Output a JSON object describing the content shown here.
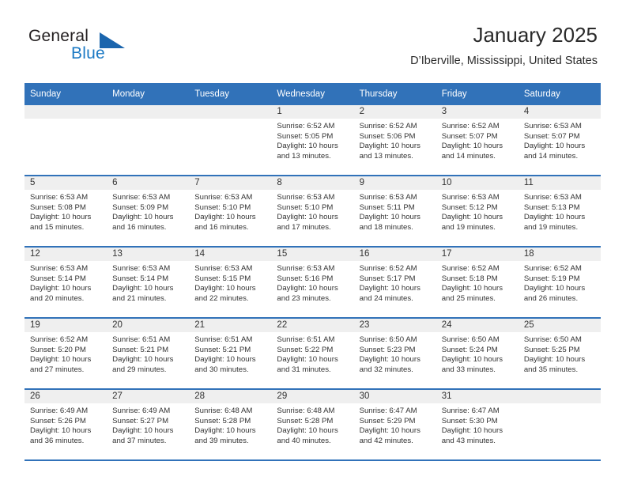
{
  "brand": {
    "name_top": "General",
    "name_bottom": "Blue",
    "accent_color": "#1b79c4",
    "triangle_color": "#1b65ad"
  },
  "header": {
    "title": "January 2025",
    "subtitle": "D’Iberville, Mississippi, United States"
  },
  "theme": {
    "header_blue": "#3172b9",
    "daynum_band": "#efefef",
    "text": "#333333"
  },
  "weekdays": [
    "Sunday",
    "Monday",
    "Tuesday",
    "Wednesday",
    "Thursday",
    "Friday",
    "Saturday"
  ],
  "weeks": [
    [
      {
        "day": "",
        "sunrise": "",
        "sunset": "",
        "daylight": ""
      },
      {
        "day": "",
        "sunrise": "",
        "sunset": "",
        "daylight": ""
      },
      {
        "day": "",
        "sunrise": "",
        "sunset": "",
        "daylight": ""
      },
      {
        "day": "1",
        "sunrise": "Sunrise: 6:52 AM",
        "sunset": "Sunset: 5:05 PM",
        "daylight": "Daylight: 10 hours and 13 minutes."
      },
      {
        "day": "2",
        "sunrise": "Sunrise: 6:52 AM",
        "sunset": "Sunset: 5:06 PM",
        "daylight": "Daylight: 10 hours and 13 minutes."
      },
      {
        "day": "3",
        "sunrise": "Sunrise: 6:52 AM",
        "sunset": "Sunset: 5:07 PM",
        "daylight": "Daylight: 10 hours and 14 minutes."
      },
      {
        "day": "4",
        "sunrise": "Sunrise: 6:53 AM",
        "sunset": "Sunset: 5:07 PM",
        "daylight": "Daylight: 10 hours and 14 minutes."
      }
    ],
    [
      {
        "day": "5",
        "sunrise": "Sunrise: 6:53 AM",
        "sunset": "Sunset: 5:08 PM",
        "daylight": "Daylight: 10 hours and 15 minutes."
      },
      {
        "day": "6",
        "sunrise": "Sunrise: 6:53 AM",
        "sunset": "Sunset: 5:09 PM",
        "daylight": "Daylight: 10 hours and 16 minutes."
      },
      {
        "day": "7",
        "sunrise": "Sunrise: 6:53 AM",
        "sunset": "Sunset: 5:10 PM",
        "daylight": "Daylight: 10 hours and 16 minutes."
      },
      {
        "day": "8",
        "sunrise": "Sunrise: 6:53 AM",
        "sunset": "Sunset: 5:10 PM",
        "daylight": "Daylight: 10 hours and 17 minutes."
      },
      {
        "day": "9",
        "sunrise": "Sunrise: 6:53 AM",
        "sunset": "Sunset: 5:11 PM",
        "daylight": "Daylight: 10 hours and 18 minutes."
      },
      {
        "day": "10",
        "sunrise": "Sunrise: 6:53 AM",
        "sunset": "Sunset: 5:12 PM",
        "daylight": "Daylight: 10 hours and 19 minutes."
      },
      {
        "day": "11",
        "sunrise": "Sunrise: 6:53 AM",
        "sunset": "Sunset: 5:13 PM",
        "daylight": "Daylight: 10 hours and 19 minutes."
      }
    ],
    [
      {
        "day": "12",
        "sunrise": "Sunrise: 6:53 AM",
        "sunset": "Sunset: 5:14 PM",
        "daylight": "Daylight: 10 hours and 20 minutes."
      },
      {
        "day": "13",
        "sunrise": "Sunrise: 6:53 AM",
        "sunset": "Sunset: 5:14 PM",
        "daylight": "Daylight: 10 hours and 21 minutes."
      },
      {
        "day": "14",
        "sunrise": "Sunrise: 6:53 AM",
        "sunset": "Sunset: 5:15 PM",
        "daylight": "Daylight: 10 hours and 22 minutes."
      },
      {
        "day": "15",
        "sunrise": "Sunrise: 6:53 AM",
        "sunset": "Sunset: 5:16 PM",
        "daylight": "Daylight: 10 hours and 23 minutes."
      },
      {
        "day": "16",
        "sunrise": "Sunrise: 6:52 AM",
        "sunset": "Sunset: 5:17 PM",
        "daylight": "Daylight: 10 hours and 24 minutes."
      },
      {
        "day": "17",
        "sunrise": "Sunrise: 6:52 AM",
        "sunset": "Sunset: 5:18 PM",
        "daylight": "Daylight: 10 hours and 25 minutes."
      },
      {
        "day": "18",
        "sunrise": "Sunrise: 6:52 AM",
        "sunset": "Sunset: 5:19 PM",
        "daylight": "Daylight: 10 hours and 26 minutes."
      }
    ],
    [
      {
        "day": "19",
        "sunrise": "Sunrise: 6:52 AM",
        "sunset": "Sunset: 5:20 PM",
        "daylight": "Daylight: 10 hours and 27 minutes."
      },
      {
        "day": "20",
        "sunrise": "Sunrise: 6:51 AM",
        "sunset": "Sunset: 5:21 PM",
        "daylight": "Daylight: 10 hours and 29 minutes."
      },
      {
        "day": "21",
        "sunrise": "Sunrise: 6:51 AM",
        "sunset": "Sunset: 5:21 PM",
        "daylight": "Daylight: 10 hours and 30 minutes."
      },
      {
        "day": "22",
        "sunrise": "Sunrise: 6:51 AM",
        "sunset": "Sunset: 5:22 PM",
        "daylight": "Daylight: 10 hours and 31 minutes."
      },
      {
        "day": "23",
        "sunrise": "Sunrise: 6:50 AM",
        "sunset": "Sunset: 5:23 PM",
        "daylight": "Daylight: 10 hours and 32 minutes."
      },
      {
        "day": "24",
        "sunrise": "Sunrise: 6:50 AM",
        "sunset": "Sunset: 5:24 PM",
        "daylight": "Daylight: 10 hours and 33 minutes."
      },
      {
        "day": "25",
        "sunrise": "Sunrise: 6:50 AM",
        "sunset": "Sunset: 5:25 PM",
        "daylight": "Daylight: 10 hours and 35 minutes."
      }
    ],
    [
      {
        "day": "26",
        "sunrise": "Sunrise: 6:49 AM",
        "sunset": "Sunset: 5:26 PM",
        "daylight": "Daylight: 10 hours and 36 minutes."
      },
      {
        "day": "27",
        "sunrise": "Sunrise: 6:49 AM",
        "sunset": "Sunset: 5:27 PM",
        "daylight": "Daylight: 10 hours and 37 minutes."
      },
      {
        "day": "28",
        "sunrise": "Sunrise: 6:48 AM",
        "sunset": "Sunset: 5:28 PM",
        "daylight": "Daylight: 10 hours and 39 minutes."
      },
      {
        "day": "29",
        "sunrise": "Sunrise: 6:48 AM",
        "sunset": "Sunset: 5:28 PM",
        "daylight": "Daylight: 10 hours and 40 minutes."
      },
      {
        "day": "30",
        "sunrise": "Sunrise: 6:47 AM",
        "sunset": "Sunset: 5:29 PM",
        "daylight": "Daylight: 10 hours and 42 minutes."
      },
      {
        "day": "31",
        "sunrise": "Sunrise: 6:47 AM",
        "sunset": "Sunset: 5:30 PM",
        "daylight": "Daylight: 10 hours and 43 minutes."
      },
      {
        "day": "",
        "sunrise": "",
        "sunset": "",
        "daylight": ""
      }
    ]
  ]
}
